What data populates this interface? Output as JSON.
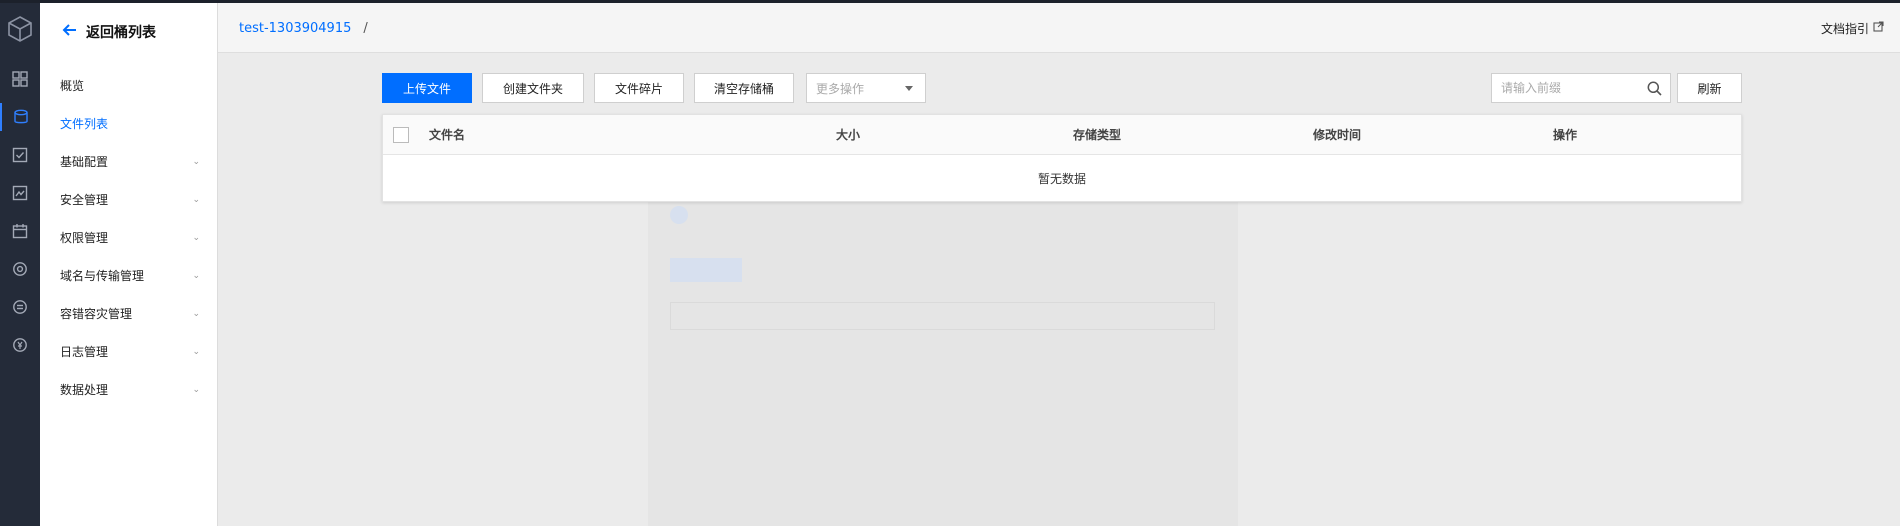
{
  "header": {
    "bucket": "test-1303904915",
    "separator": "/",
    "doc_guide": "文档指引"
  },
  "sidebar": {
    "back_label": "返回桶列表",
    "items": [
      {
        "label": "概览",
        "expandable": false,
        "active": false
      },
      {
        "label": "文件列表",
        "expandable": false,
        "active": true
      },
      {
        "label": "基础配置",
        "expandable": true,
        "active": false
      },
      {
        "label": "安全管理",
        "expandable": true,
        "active": false
      },
      {
        "label": "权限管理",
        "expandable": true,
        "active": false
      },
      {
        "label": "域名与传输管理",
        "expandable": true,
        "active": false
      },
      {
        "label": "容错容灾管理",
        "expandable": true,
        "active": false
      },
      {
        "label": "日志管理",
        "expandable": true,
        "active": false
      },
      {
        "label": "数据处理",
        "expandable": true,
        "active": false
      }
    ]
  },
  "toolbar": {
    "upload": "上传文件",
    "create_folder": "创建文件夹",
    "fragments": "文件碎片",
    "clear_bucket": "清空存储桶",
    "more_actions": "更多操作",
    "search_placeholder": "请输入前缀",
    "refresh": "刷新"
  },
  "table": {
    "columns": [
      "文件名",
      "大小",
      "存储类型",
      "修改时间",
      "操作"
    ],
    "empty_text": "暂无数据"
  },
  "colors": {
    "accent": "#006eff",
    "rail_bg": "#242b39"
  }
}
